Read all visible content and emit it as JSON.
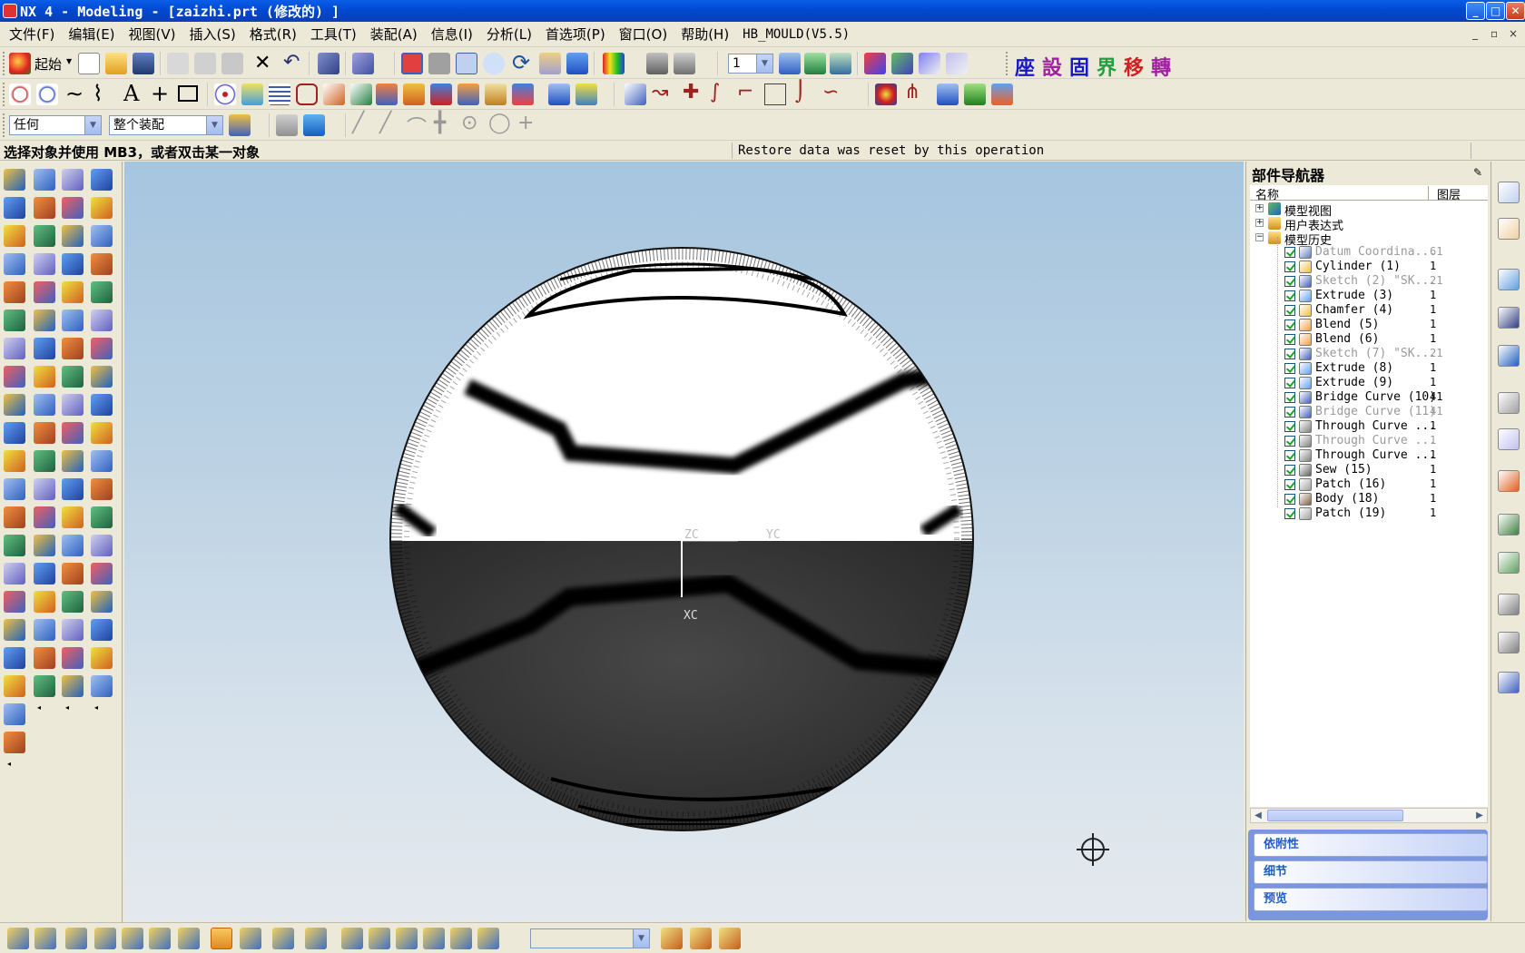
{
  "window": {
    "title": "NX 4 - Modeling - [zaizhi.prt  (修改的) ]",
    "buttons": {
      "minimize": "_",
      "maximize": "□",
      "close": "✕"
    }
  },
  "menu": {
    "items": [
      "文件(F)",
      "编辑(E)",
      "视图(V)",
      "插入(S)",
      "格式(R)",
      "工具(T)",
      "装配(A)",
      "信息(I)",
      "分析(L)",
      "首选项(P)",
      "窗口(O)",
      "帮助(H)",
      "HB_MOULD(V5.5)"
    ],
    "mdi_buttons": [
      "_",
      "▫",
      "×"
    ]
  },
  "toolbar_standard": {
    "start_label": "起始",
    "layer_value": "1",
    "chinese_buttons": [
      "座",
      "設",
      "固",
      "界",
      "移",
      "轉"
    ]
  },
  "toolbar_selection": {
    "filter_value": "任何",
    "scope_value": "整个装配"
  },
  "status": {
    "prompt": "选择对象并使用 MB3，或者双击某一对象",
    "message": "Restore data was reset by this operation"
  },
  "viewport": {
    "wcs_labels": {
      "zc": "ZC",
      "yc": "YC",
      "xc": "XC"
    }
  },
  "navigator": {
    "title": "部件导航器",
    "columns": {
      "name": "名称",
      "layer": "图层"
    },
    "roots": [
      {
        "label": "模型视图",
        "expanded": false
      },
      {
        "label": "用户表达式",
        "expanded": false
      },
      {
        "label": "模型历史",
        "expanded": true
      }
    ],
    "features": [
      {
        "name": "Datum Coordina...",
        "layer": "61",
        "dim": true,
        "icon": "datum-csys-icon"
      },
      {
        "name": "Cylinder (1)",
        "layer": "1",
        "dim": false,
        "icon": "cylinder-icon"
      },
      {
        "name": "Sketch (2) \"SK...",
        "layer": "21",
        "dim": true,
        "icon": "sketch-icon"
      },
      {
        "name": "Extrude (3)",
        "layer": "1",
        "dim": false,
        "icon": "extrude-icon"
      },
      {
        "name": "Chamfer (4)",
        "layer": "1",
        "dim": false,
        "icon": "chamfer-icon"
      },
      {
        "name": "Blend (5)",
        "layer": "1",
        "dim": false,
        "icon": "blend-icon"
      },
      {
        "name": "Blend (6)",
        "layer": "1",
        "dim": false,
        "icon": "blend-icon"
      },
      {
        "name": "Sketch (7) \"SK...",
        "layer": "21",
        "dim": true,
        "icon": "sketch-icon"
      },
      {
        "name": "Extrude (8)",
        "layer": "1",
        "dim": false,
        "icon": "extrude-icon"
      },
      {
        "name": "Extrude (9)",
        "layer": "1",
        "dim": false,
        "icon": "extrude-icon"
      },
      {
        "name": "Bridge Curve (10)",
        "layer": "41",
        "dim": false,
        "icon": "bridge-curve-icon"
      },
      {
        "name": "Bridge Curve (11)",
        "layer": "41",
        "dim": true,
        "icon": "bridge-curve-icon"
      },
      {
        "name": "Through Curve ...",
        "layer": "1",
        "dim": false,
        "icon": "through-curves-icon"
      },
      {
        "name": "Through Curve ...",
        "layer": "1",
        "dim": true,
        "icon": "through-curves-icon"
      },
      {
        "name": "Through Curve ...",
        "layer": "1",
        "dim": false,
        "icon": "through-curves-icon"
      },
      {
        "name": "Sew (15)",
        "layer": "1",
        "dim": false,
        "icon": "sew-icon"
      },
      {
        "name": "Patch (16)",
        "layer": "1",
        "dim": false,
        "icon": "patch-icon"
      },
      {
        "name": "Body (18)",
        "layer": "1",
        "dim": false,
        "icon": "body-icon"
      },
      {
        "name": "Patch (19)",
        "layer": "1",
        "dim": false,
        "icon": "patch-icon"
      }
    ],
    "panels": [
      "依附性",
      "细节",
      "预览"
    ]
  },
  "colors": {
    "titlebar": "#0049d2",
    "accent": "#215dc6",
    "chinese_button_blue": "#1818c8",
    "chinese_button_purple": "#a020a0",
    "chinese_button_green": "#20a040",
    "chinese_button_red": "#d02020"
  }
}
